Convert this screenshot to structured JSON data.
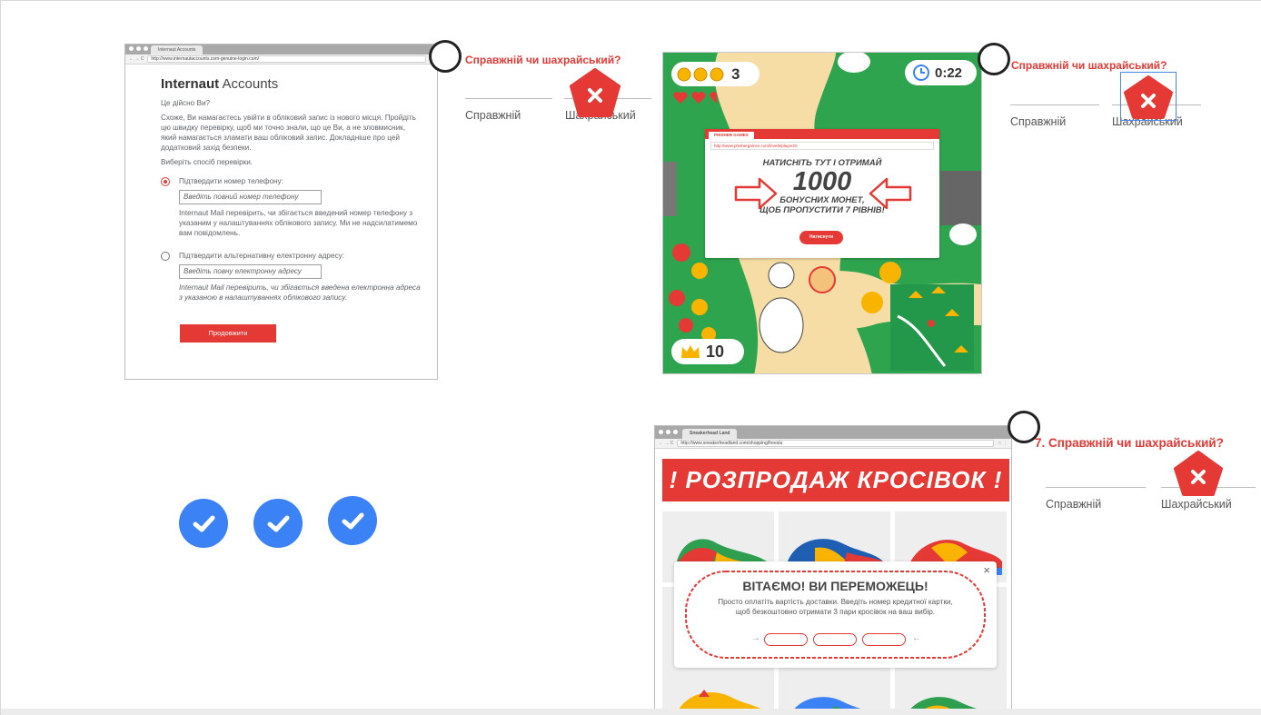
{
  "card1": {
    "browser": {
      "tab_title": "Internaut Accounts",
      "url": "http://www.internautaccounts.com-genuine-login.com/"
    },
    "title_bold": "Internaut",
    "title_rest": " Accounts",
    "question": "Це дійсно Ви?",
    "intro": "Схоже, Ви намагаєтесь увійти в обліковий запис із нового місця. Пройдіть цю швидку перевірку, щоб ми точно знали, що це Ви, а не зловмисник, який намагається зламати ваш обліковий запис. Докладніше про цей додатковий захід безпеки.",
    "choose": "Виберіть спосіб перевірки.",
    "option_phone": {
      "label": "Підтвердити номер телефону:",
      "placeholder": "Введіть повний номер телефону",
      "help": "Internaut Mail перевірить, чи збігається введений номер телефону з указаним у налаштуваннях облікового запису. Ми не надсилатимемо вам повідомлень."
    },
    "option_email": {
      "label": "Підтвердити альтернативну електронну адресу:",
      "placeholder": "Введіть повну електронну адресу",
      "help": "Internaut Mail перевірить, чи збігається введена електронна адреса з указаною в налаштуваннях облікового запису."
    },
    "continue_label": "Продовжити"
  },
  "questions": [
    {
      "title": "Справжній чи шахрайський?",
      "real_label": "Справжній",
      "fake_label": "Шахрайський",
      "selected": "fake"
    },
    {
      "title": "Справжній чи шахрайський?",
      "real_label": "Справжній",
      "fake_label": "Шахрайський",
      "selected": "fake"
    },
    {
      "title": "7. Справжній чи шахрайський?",
      "real_label": "Справжній",
      "fake_label": "Шахрайський",
      "selected": "fake"
    }
  ],
  "card2": {
    "coins_count": "3",
    "timer": "0:22",
    "crowns": "10",
    "popup": {
      "tab": "PHISHER GAMES",
      "url": "http://www.phishergames.com/level6/player20",
      "line1": "НАТИСНІТЬ ТУТ І ОТРИМАЙ",
      "big": "1000",
      "line2": "БОНУСНИХ МОНЕТ,",
      "line3": "ЩОБ ПРОПУСТИТИ 7 РІВНІВ!",
      "button": "Натиснути"
    }
  },
  "card3": {
    "browser": {
      "tab_title": "Sneakerhead Land",
      "url": "http://www.sneakerheadland.com/shopping/freestu"
    },
    "banner": "! РОЗПРОДАЖ КРОСІВОК !",
    "popup": {
      "title": "ВІТАЄМО! ВИ ПЕРЕМОЖЕЦЬ!",
      "text_line1": "Просто оплатіть вартість доставки. Введіть номер кредитної картки,",
      "text_line2": "щоб безкоштовно отримати 3 пари кросівок на ваш вибір.",
      "close": "×"
    }
  },
  "colors": {
    "accent_red": "#e53935",
    "check_blue": "#3b82f6",
    "game_green": "#2e9e4f",
    "path_sand": "#f6dda6"
  }
}
